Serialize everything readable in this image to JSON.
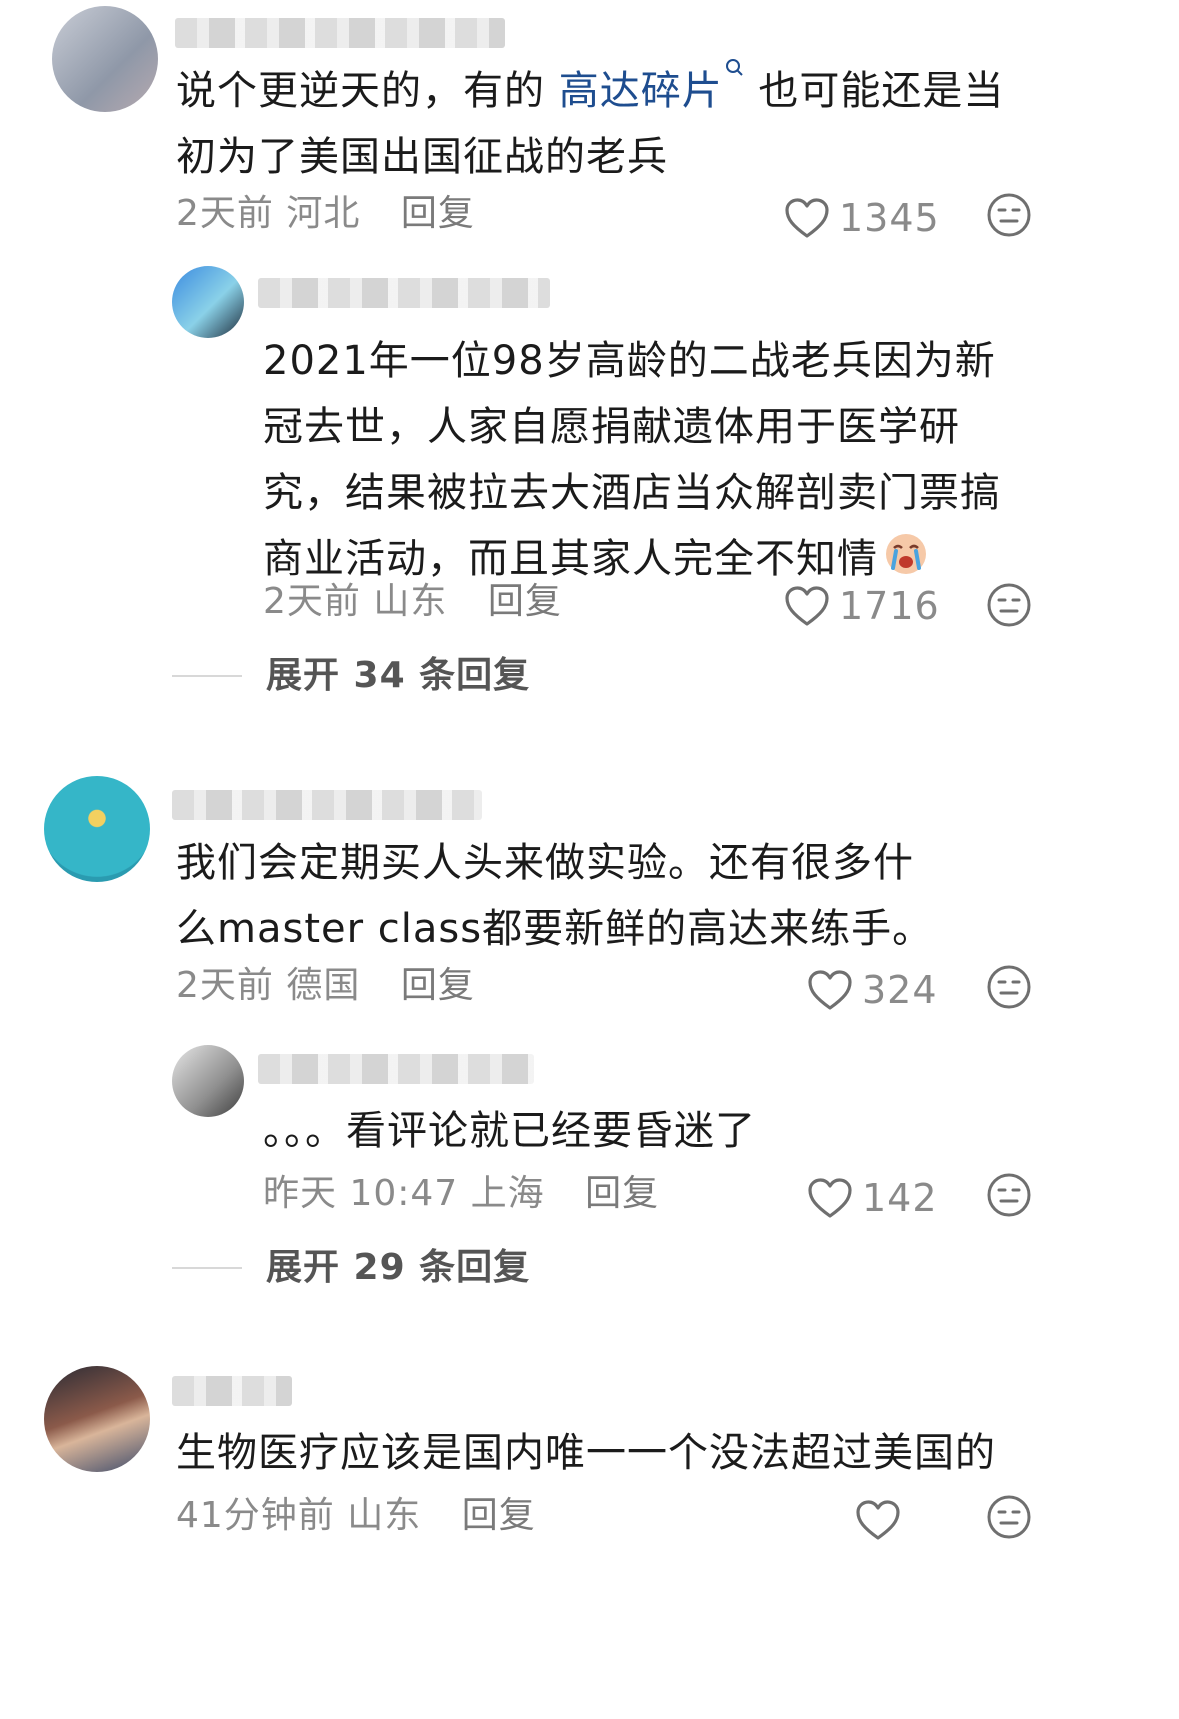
{
  "comments": [
    {
      "text_pre": "说个更逆天的，有的 ",
      "link": "高达碎片",
      "text_post": " 也可能还是当初为了美国出国征战的老兵",
      "time": "2天前",
      "location": "河北",
      "reply_label": "回复",
      "likes": "1345",
      "replies": [
        {
          "text": "2021年一位98岁高龄的二战老兵因为新冠去世，人家自愿捐献遗体用于医学研究，结果被拉去大酒店当众解剖卖门票搞商业活动，而且其家人完全不知情",
          "emoji": "crying-face",
          "time": "2天前",
          "location": "山东",
          "reply_label": "回复",
          "likes": "1716"
        }
      ],
      "expand_label": "展开 34 条回复"
    },
    {
      "text": "我们会定期买人头来做实验。还有很多什么master class都要新鲜的高达来练手。",
      "time": "2天前",
      "location": "德国",
      "reply_label": "回复",
      "likes": "324",
      "replies": [
        {
          "text": "。。。看评论就已经要昏迷了",
          "time": "昨天 10:47",
          "location": "上海",
          "reply_label": "回复",
          "likes": "142"
        }
      ],
      "expand_label": "展开 29 条回复"
    },
    {
      "text": "生物医疗应该是国内唯一一个没法超过美国的",
      "time": "41分钟前",
      "location": "山东",
      "reply_label": "回复",
      "likes": ""
    }
  ],
  "colors": {
    "text": "#1b1b1b",
    "meta": "#8a8a8a",
    "link": "#1e4d8f"
  }
}
